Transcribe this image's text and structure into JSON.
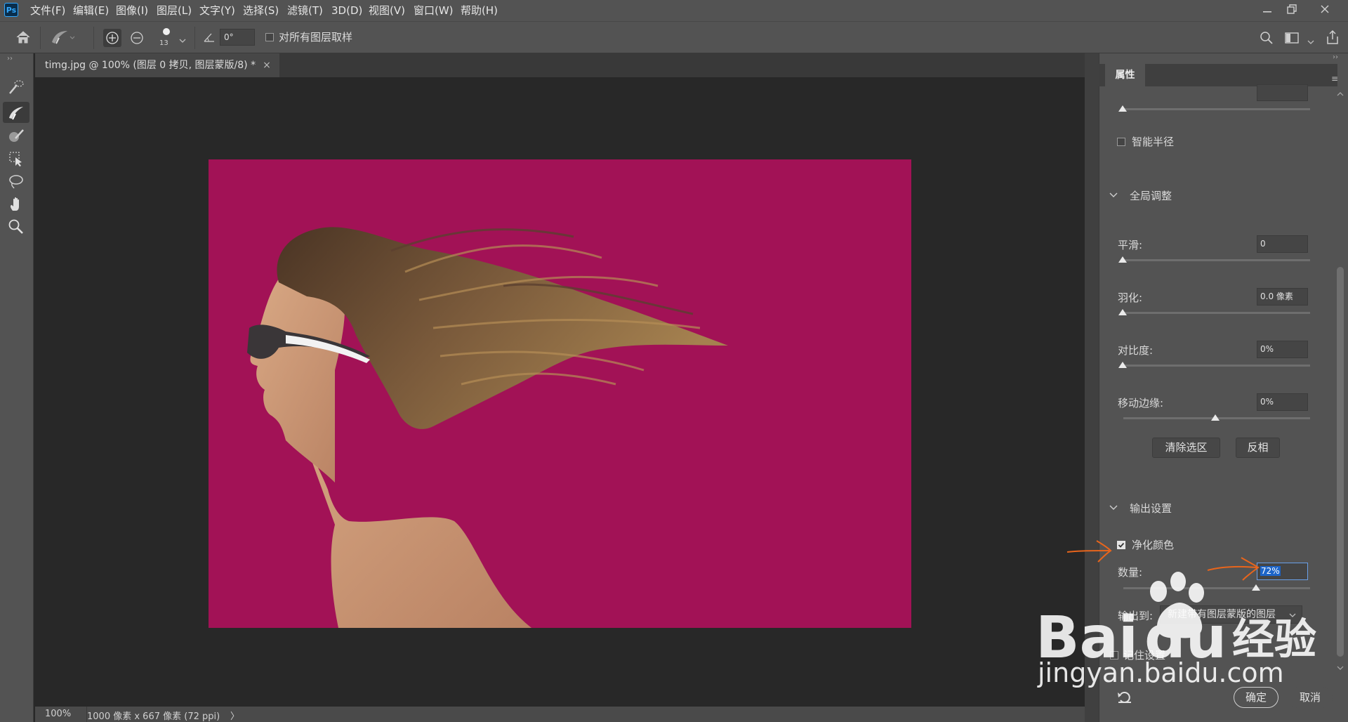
{
  "menubar": {
    "app_icon": "Ps",
    "items": [
      "文件(F)",
      "编辑(E)",
      "图像(I)",
      "图层(L)",
      "文字(Y)",
      "选择(S)",
      "滤镜(T)",
      "3D(D)",
      "视图(V)",
      "窗口(W)",
      "帮助(H)"
    ],
    "window_controls": [
      "minimize-icon",
      "restore-icon",
      "close-icon"
    ]
  },
  "optionsbar": {
    "brush_size": "13",
    "angle": "0°",
    "sample_all_layers_label": "对所有图层取样",
    "sample_all_layers_checked": false
  },
  "document": {
    "tab_title": "timg.jpg @ 100% (图层 0 拷贝, 图层蒙版/8) *",
    "close_glyph": "×",
    "background_color": "#a21256"
  },
  "statusbar": {
    "zoom": "100%",
    "doc_info": "1000 像素 x 667 像素 (72 ppi)",
    "arrow": "〉"
  },
  "properties": {
    "tab_label": "属性",
    "smart_radius_label": "智能半径",
    "smart_radius_checked": false,
    "global_section_title": "全局调整",
    "smooth": {
      "label": "平滑:",
      "value": "0",
      "slider": 0
    },
    "feather": {
      "label": "羽化:",
      "value": "0.0 像素",
      "slider": 0
    },
    "contrast": {
      "label": "对比度:",
      "value": "0%",
      "slider": 0
    },
    "shift_edge": {
      "label": "移动边缘:",
      "value": "0%",
      "slider": 0.5
    },
    "clear_selection_label": "清除选区",
    "invert_label": "反相",
    "output_section_title": "输出设置",
    "decontaminate_label": "净化颜色",
    "decontaminate_checked": true,
    "amount": {
      "label": "数量:",
      "value": "72%",
      "slider": 0.72
    },
    "output_to_label": "输出到:",
    "output_to_value": "新建带有图层蒙版的图层",
    "remember_label": "记住设置",
    "ok_label": "确定",
    "cancel_label": "取消"
  },
  "watermark": {
    "logo_text_left": "Bai",
    "logo_text_right": "du",
    "logo_suffix": "经验",
    "url": "jingyan.baidu.com"
  },
  "colors": {
    "annotation_arrow": "#e8651c",
    "selection_highlight": "#1d65c9"
  }
}
